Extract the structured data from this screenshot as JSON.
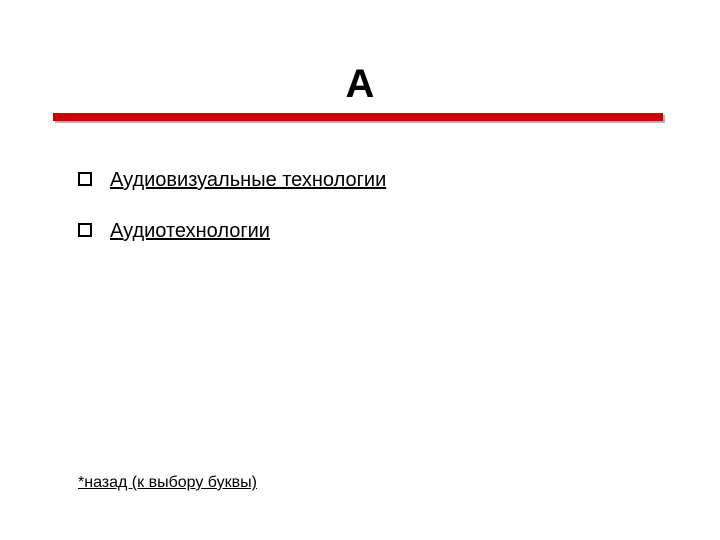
{
  "title": "А",
  "items": [
    {
      "label": "Аудиовизуальные технологии"
    },
    {
      "label": "Аудиотехнологии"
    }
  ],
  "back_label": "*назад (к выбору буквы)",
  "colors": {
    "accent": "#cc0000"
  }
}
